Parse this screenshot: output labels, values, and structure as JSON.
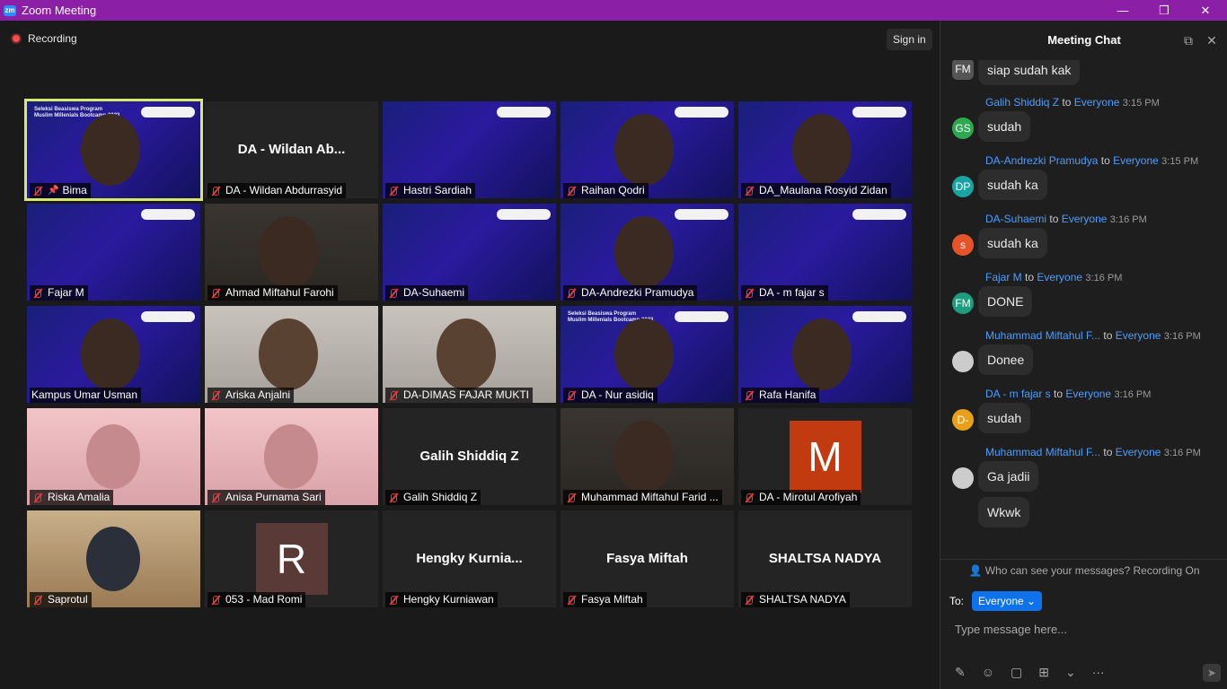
{
  "window": {
    "title": "Zoom Meeting",
    "app_icon": "zm"
  },
  "controls": {
    "minimize": "—",
    "restore": "❐",
    "close": "✕"
  },
  "recording": {
    "label": "Recording"
  },
  "signin": {
    "label": "Sign in"
  },
  "slide": {
    "line1": "Seleksi Beasiswa Program",
    "line2": "Muslim Millenials Bootcamp 2023"
  },
  "tiles": [
    {
      "name": "Bima",
      "active": true
    },
    {
      "name": "DA - Wildan Abdurrasyid",
      "center": "DA - Wildan Ab..."
    },
    {
      "name": "Hastri Sardiah"
    },
    {
      "name": "Raihan Qodri"
    },
    {
      "name": "DA_Maulana Rosyid Zidan"
    },
    {
      "name": "Fajar M"
    },
    {
      "name": "Ahmad Miftahul Farohi"
    },
    {
      "name": "DA-Suhaemi"
    },
    {
      "name": "DA-Andrezki Pramudya"
    },
    {
      "name": "DA - m fajar s"
    },
    {
      "name": "Kampus Umar Usman"
    },
    {
      "name": "Ariska Anjalni"
    },
    {
      "name": "DA-DIMAS FAJAR MUKTI"
    },
    {
      "name": "DA - Nur asidiq"
    },
    {
      "name": "Rafa Hanifa"
    },
    {
      "name": "Riska Amalia"
    },
    {
      "name": "Anisa Purnama Sari"
    },
    {
      "name": "Galih Shiddiq Z",
      "center": "Galih Shiddiq Z"
    },
    {
      "name": "Muhammad Miftahul Farid ..."
    },
    {
      "name": "DA - Mirotul Arofiyah",
      "avatar": "M"
    },
    {
      "name": "Saprotul"
    },
    {
      "name": "053 - Mad Romi",
      "avatar": "R"
    },
    {
      "name": "Hengky Kurniawan",
      "center": "Hengky  Kurnia..."
    },
    {
      "name": "Fasya Miftah",
      "center": "Fasya Miftah"
    },
    {
      "name": "SHALTSA NADYA",
      "center": "SHALTSA NADYA"
    }
  ],
  "chat": {
    "title": "Meeting Chat",
    "first_avatar": "FM",
    "first_text": "siap sudah kak",
    "messages": [
      {
        "from": "Galih Shiddiq Z",
        "to": "Everyone",
        "time": "3:15 PM",
        "avatar": "GS",
        "color": "#2ea84e",
        "texts": [
          "sudah"
        ]
      },
      {
        "from": "DA-Andrezki Pramudya",
        "to": "Everyone",
        "time": "3:15 PM",
        "avatar": "DP",
        "color": "#1aa3a3",
        "texts": [
          "sudah ka"
        ]
      },
      {
        "from": "DA-Suhaemi",
        "to": "Everyone",
        "time": "3:16 PM",
        "avatar": "s",
        "color": "#e8542a",
        "texts": [
          "sudah ka"
        ]
      },
      {
        "from": "Fajar M",
        "to": "Everyone",
        "time": "3:16 PM",
        "avatar": "FM",
        "color": "#1c9e7e",
        "texts": [
          "DONE"
        ]
      },
      {
        "from": "Muhammad Miftahul F...",
        "to": "Everyone",
        "time": "3:16 PM",
        "avatar": "",
        "color": "#cccccc",
        "texts": [
          "Donee"
        ]
      },
      {
        "from": "DA - m fajar s",
        "to": "Everyone",
        "time": "3:16 PM",
        "avatar": "D-",
        "color": "#e8a01a",
        "texts": [
          "sudah"
        ]
      },
      {
        "from": "Muhammad Miftahul F...",
        "to": "Everyone",
        "time": "3:16 PM",
        "avatar": "",
        "color": "#cccccc",
        "texts": [
          "Ga jadii",
          "Wkwk"
        ]
      }
    ],
    "privacy": "Who can see your messages? Recording On",
    "to_label": "To:",
    "to_value": "Everyone",
    "placeholder": "Type message here..."
  }
}
